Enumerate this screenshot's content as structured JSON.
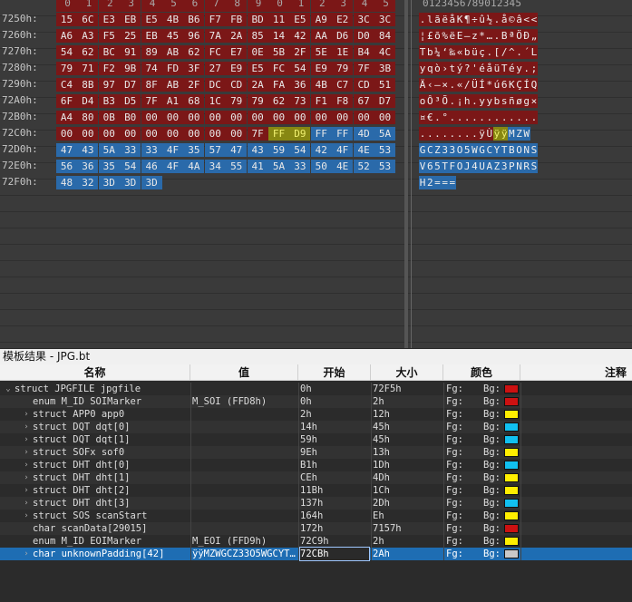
{
  "hex": {
    "header_digits": [
      "0",
      "1",
      "2",
      "3",
      "4",
      "5",
      "6",
      "7",
      "8",
      "9",
      "0",
      "1",
      "2",
      "3",
      "4",
      "5"
    ],
    "ascii_header": "0123456789012345",
    "rows": [
      {
        "addr": "",
        "bytes": [
          "",
          "",
          "",
          "",
          "",
          "",
          "",
          "",
          "",
          "",
          "",
          "",
          "",
          "",
          "",
          ""
        ],
        "ascii": "",
        "colors": [
          "r",
          "r",
          "r",
          "r",
          "r",
          "r",
          "r",
          "r",
          "r",
          "r",
          "r",
          "r",
          "r",
          "r",
          "r",
          "r"
        ]
      },
      {
        "addr": "7250h:",
        "bytes": [
          "15",
          "6C",
          "E3",
          "EB",
          "E5",
          "4B",
          "B6",
          "F7",
          "FB",
          "BD",
          "11",
          "E5",
          "A9",
          "E2",
          "3C",
          "3C"
        ],
        "ascii": ".lãëåK¶÷û½.å©â<<",
        "colors": [
          "r",
          "r",
          "r",
          "r",
          "r",
          "r",
          "r",
          "r",
          "r",
          "r",
          "r",
          "r",
          "r",
          "r",
          "r",
          "r"
        ]
      },
      {
        "addr": "7260h:",
        "bytes": [
          "A6",
          "A3",
          "F5",
          "25",
          "EB",
          "45",
          "96",
          "7A",
          "2A",
          "85",
          "14",
          "42",
          "AA",
          "D6",
          "D0",
          "84"
        ],
        "ascii": "¦£õ%ëE–z*….BªÖÐ„",
        "colors": [
          "r",
          "r",
          "r",
          "r",
          "r",
          "r",
          "r",
          "r",
          "r",
          "r",
          "r",
          "r",
          "r",
          "r",
          "r",
          "r"
        ]
      },
      {
        "addr": "7270h:",
        "bytes": [
          "54",
          "62",
          "BC",
          "91",
          "89",
          "AB",
          "62",
          "FC",
          "E7",
          "0E",
          "5B",
          "2F",
          "5E",
          "1E",
          "B4",
          "4C"
        ],
        "ascii": "Tb¼‘‰«büç.[/^.´L",
        "colors": [
          "r",
          "r",
          "r",
          "r",
          "r",
          "r",
          "r",
          "r",
          "r",
          "r",
          "r",
          "r",
          "r",
          "r",
          "r",
          "r"
        ]
      },
      {
        "addr": "7280h:",
        "bytes": [
          "79",
          "71",
          "F2",
          "9B",
          "74",
          "FD",
          "3F",
          "27",
          "E9",
          "E5",
          "FC",
          "54",
          "E9",
          "79",
          "7F",
          "3B"
        ],
        "ascii": "yqò›tý?'éåüTéy.;",
        "colors": [
          "r",
          "r",
          "r",
          "r",
          "r",
          "r",
          "r",
          "r",
          "r",
          "r",
          "r",
          "r",
          "r",
          "r",
          "r",
          "r"
        ]
      },
      {
        "addr": "7290h:",
        "bytes": [
          "C4",
          "8B",
          "97",
          "D7",
          "8F",
          "AB",
          "2F",
          "DC",
          "CD",
          "2A",
          "FA",
          "36",
          "4B",
          "C7",
          "CD",
          "51"
        ],
        "ascii": "Ä‹—×.«/ÜÍ*ú6KÇÍQ",
        "colors": [
          "r",
          "r",
          "r",
          "r",
          "r",
          "r",
          "r",
          "r",
          "r",
          "r",
          "r",
          "r",
          "r",
          "r",
          "r",
          "r"
        ]
      },
      {
        "addr": "72A0h:",
        "bytes": [
          "6F",
          "D4",
          "B3",
          "D5",
          "7F",
          "A1",
          "68",
          "1C",
          "79",
          "79",
          "62",
          "73",
          "F1",
          "F8",
          "67",
          "D7"
        ],
        "ascii": "oÔ³Õ.¡h.yybsñøg×",
        "colors": [
          "r",
          "r",
          "r",
          "r",
          "r",
          "r",
          "r",
          "r",
          "r",
          "r",
          "r",
          "r",
          "r",
          "r",
          "r",
          "r"
        ]
      },
      {
        "addr": "72B0h:",
        "bytes": [
          "A4",
          "80",
          "0B",
          "B0",
          "00",
          "00",
          "00",
          "00",
          "00",
          "00",
          "00",
          "00",
          "00",
          "00",
          "00",
          "00"
        ],
        "ascii": "¤€.°............",
        "colors": [
          "r",
          "r",
          "r",
          "r",
          "r",
          "r",
          "r",
          "r",
          "r",
          "r",
          "r",
          "r",
          "r",
          "r",
          "r",
          "r"
        ]
      },
      {
        "addr": "72C0h:",
        "bytes": [
          "00",
          "00",
          "00",
          "00",
          "00",
          "00",
          "00",
          "00",
          "00",
          "7F",
          "FF",
          "D9",
          "FF",
          "FF",
          "4D",
          "5A",
          "57"
        ],
        "ascii": "........ÿÙÿÿMZW",
        "colors": [
          "r",
          "r",
          "r",
          "r",
          "r",
          "r",
          "r",
          "r",
          "r",
          "r",
          "y",
          "y",
          "b",
          "b",
          "b",
          "b"
        ]
      },
      {
        "addr": "72D0h:",
        "bytes": [
          "47",
          "43",
          "5A",
          "33",
          "33",
          "4F",
          "35",
          "57",
          "47",
          "43",
          "59",
          "54",
          "42",
          "4F",
          "4E",
          "53"
        ],
        "ascii": "GCZ33O5WGCYTBONS",
        "colors": [
          "b",
          "b",
          "b",
          "b",
          "b",
          "b",
          "b",
          "b",
          "b",
          "b",
          "b",
          "b",
          "b",
          "b",
          "b",
          "b"
        ]
      },
      {
        "addr": "72E0h:",
        "bytes": [
          "56",
          "36",
          "35",
          "54",
          "46",
          "4F",
          "4A",
          "34",
          "55",
          "41",
          "5A",
          "33",
          "50",
          "4E",
          "52",
          "53"
        ],
        "ascii": "V65TFOJ4UAZ3PNRS",
        "colors": [
          "b",
          "b",
          "b",
          "b",
          "b",
          "b",
          "b",
          "b",
          "b",
          "b",
          "b",
          "b",
          "b",
          "b",
          "b",
          "b"
        ]
      },
      {
        "addr": "72F0h:",
        "bytes": [
          "48",
          "32",
          "3D",
          "3D",
          "3D",
          "",
          "",
          "",
          "",
          "",
          "",
          "",
          "",
          "",
          "",
          ""
        ],
        "ascii": "H2===",
        "colors": [
          "b",
          "b",
          "b",
          "b",
          "b",
          "",
          "",
          "",
          "",
          "",
          "",
          "",
          "",
          "",
          "",
          ""
        ]
      }
    ]
  },
  "template": {
    "title": "模板结果 - JPG.bt",
    "columns": {
      "name": "名称",
      "value": "值",
      "start": "开始",
      "size": "大小",
      "color": "颜色",
      "comment": "注释"
    },
    "fg_label": "Fg:",
    "bg_label": "Bg:",
    "rows": [
      {
        "name": "struct JPGFILE jpgfile",
        "value": "",
        "start": "0h",
        "size": "72F5h",
        "bg": "#cc1111",
        "expander": "v",
        "indent": 0
      },
      {
        "name": "enum M_ID SOIMarker",
        "value": "M_SOI (FFD8h)",
        "start": "0h",
        "size": "2h",
        "bg": "#cc1111",
        "expander": "",
        "indent": 1
      },
      {
        "name": "struct APP0 app0",
        "value": "",
        "start": "2h",
        "size": "12h",
        "bg": "#ffee00",
        "expander": ">",
        "indent": 1
      },
      {
        "name": "struct DQT dqt[0]",
        "value": "",
        "start": "14h",
        "size": "45h",
        "bg": "#11c0f0",
        "expander": ">",
        "indent": 1
      },
      {
        "name": "struct DQT dqt[1]",
        "value": "",
        "start": "59h",
        "size": "45h",
        "bg": "#11c0f0",
        "expander": ">",
        "indent": 1
      },
      {
        "name": "struct SOFx sof0",
        "value": "",
        "start": "9Eh",
        "size": "13h",
        "bg": "#ffee00",
        "expander": ">",
        "indent": 1
      },
      {
        "name": "struct DHT dht[0]",
        "value": "",
        "start": "B1h",
        "size": "1Dh",
        "bg": "#11c0f0",
        "expander": ">",
        "indent": 1
      },
      {
        "name": "struct DHT dht[1]",
        "value": "",
        "start": "CEh",
        "size": "4Dh",
        "bg": "#ffee00",
        "expander": ">",
        "indent": 1
      },
      {
        "name": "struct DHT dht[2]",
        "value": "",
        "start": "11Bh",
        "size": "1Ch",
        "bg": "#ffee00",
        "expander": ">",
        "indent": 1
      },
      {
        "name": "struct DHT dht[3]",
        "value": "",
        "start": "137h",
        "size": "2Dh",
        "bg": "#11c0f0",
        "expander": ">",
        "indent": 1
      },
      {
        "name": "struct SOS scanStart",
        "value": "",
        "start": "164h",
        "size": "Eh",
        "bg": "#ffee00",
        "expander": ">",
        "indent": 1
      },
      {
        "name": "char scanData[29015]",
        "value": "",
        "start": "172h",
        "size": "7157h",
        "bg": "#cc1111",
        "expander": "",
        "indent": 1
      },
      {
        "name": "enum M_ID EOIMarker",
        "value": "M_EOI (FFD9h)",
        "start": "72C9h",
        "size": "2h",
        "bg": "#ffee00",
        "expander": "",
        "indent": 1
      },
      {
        "name": "char unknownPadding[42]",
        "value": "ÿÿMZWGCZ33O5WGCYT…",
        "start": "72CBh",
        "size": "2Ah",
        "bg": "#c8c8c8",
        "expander": ">",
        "indent": 1
      }
    ]
  }
}
